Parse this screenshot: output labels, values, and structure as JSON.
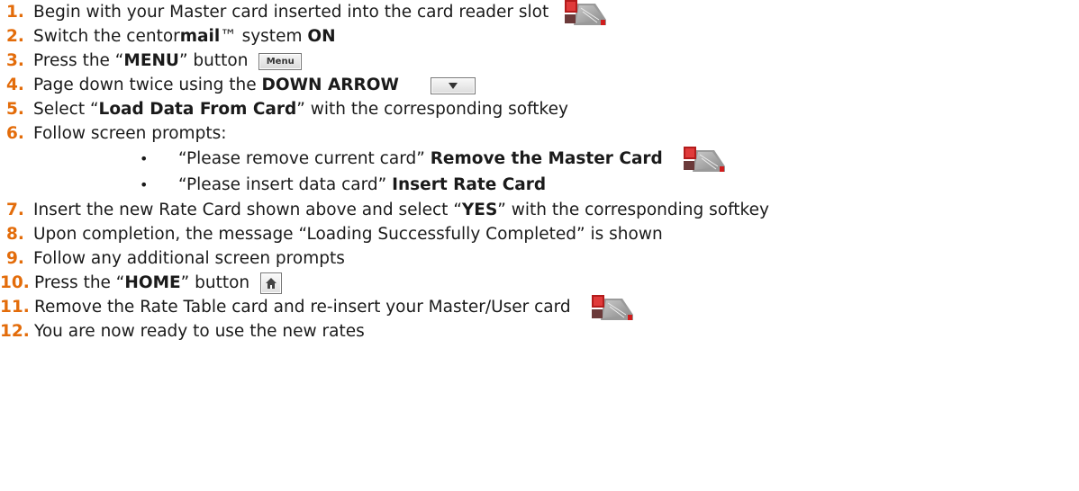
{
  "steps": [
    {
      "num": "1.",
      "parts": [
        {
          "t": "Begin with your Master card inserted into the card reader slot",
          "b": false
        }
      ]
    },
    {
      "num": "2.",
      "parts": [
        {
          "t": "Switch the centor",
          "b": false
        },
        {
          "t": "mail",
          "b": true
        },
        {
          "t": "™ system ",
          "b": false
        },
        {
          "t": "ON",
          "b": true
        }
      ]
    },
    {
      "num": "3.",
      "parts": [
        {
          "t": "Press the “",
          "b": false
        },
        {
          "t": "MENU",
          "b": true
        },
        {
          "t": "” button",
          "b": false
        }
      ]
    },
    {
      "num": "4.",
      "parts": [
        {
          "t": "Page down twice using the ",
          "b": false
        },
        {
          "t": "DOWN ARROW",
          "b": true
        }
      ]
    },
    {
      "num": "5.",
      "parts": [
        {
          "t": "Select “",
          "b": false
        },
        {
          "t": "Load Data From Card",
          "b": true
        },
        {
          "t": "” with the corresponding softkey",
          "b": false
        }
      ]
    },
    {
      "num": "6.",
      "parts": [
        {
          "t": "Follow screen prompts:",
          "b": false
        }
      ]
    },
    {
      "num": "7.",
      "parts": [
        {
          "t": "Insert the new Rate Card shown above and select “",
          "b": false
        },
        {
          "t": "YES",
          "b": true
        },
        {
          "t": "” with the corresponding softkey",
          "b": false
        }
      ]
    },
    {
      "num": "8.",
      "parts": [
        {
          "t": "Upon completion, the message “Loading Successfully Completed” is shown",
          "b": false
        }
      ]
    },
    {
      "num": "9.",
      "parts": [
        {
          "t": "Follow any additional screen prompts",
          "b": false
        }
      ]
    },
    {
      "num": "10.",
      "parts": [
        {
          "t": "Press the “",
          "b": false
        },
        {
          "t": "HOME",
          "b": true
        },
        {
          "t": "” button",
          "b": false
        }
      ]
    },
    {
      "num": "11.",
      "parts": [
        {
          "t": "Remove the Rate Table card and re-insert your Master/User card",
          "b": false
        }
      ]
    },
    {
      "num": "12.",
      "parts": [
        {
          "t": "You are now ready to use the new rates",
          "b": false
        }
      ]
    }
  ],
  "prompts": [
    {
      "bullet": "•",
      "quote": "“Please remove current card” ",
      "action": "Remove the Master Card"
    },
    {
      "bullet": "•",
      "quote": "“Please insert data card” ",
      "action": "Insert Rate Card"
    }
  ],
  "keys": {
    "menu_label": "Menu"
  },
  "icons": {
    "card": "card-icon",
    "home": "home-icon",
    "down": "down-arrow-icon"
  },
  "colors": {
    "number": "#e36c0a",
    "text": "#1a1a1a"
  }
}
